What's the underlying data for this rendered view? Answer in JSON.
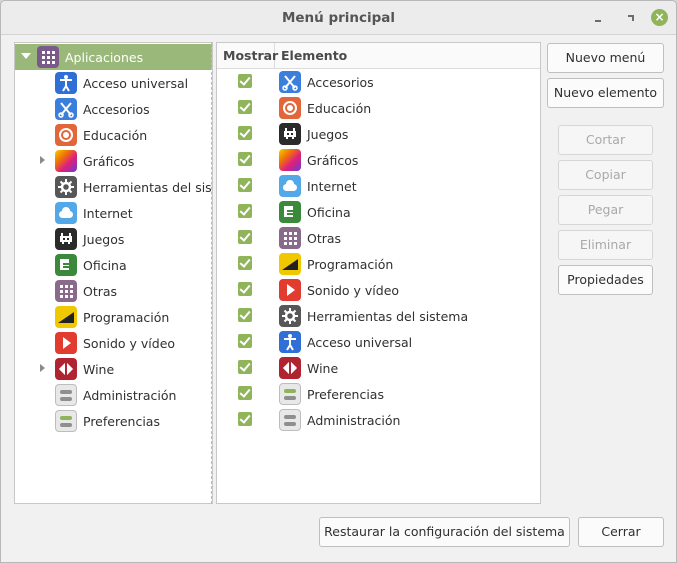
{
  "window": {
    "title": "Menú principal"
  },
  "tree": {
    "items": [
      {
        "label": "Aplicaciones",
        "icon": "applications-icon"
      },
      {
        "label": "Acceso universal",
        "icon": "accessibility-icon"
      },
      {
        "label": "Accesorios",
        "icon": "accessories-icon"
      },
      {
        "label": "Educación",
        "icon": "education-icon"
      },
      {
        "label": "Gráficos",
        "icon": "graphics-icon"
      },
      {
        "label": "Herramientas del sister",
        "icon": "system-tools-icon"
      },
      {
        "label": "Internet",
        "icon": "internet-icon"
      },
      {
        "label": "Juegos",
        "icon": "games-icon"
      },
      {
        "label": "Oficina",
        "icon": "office-icon"
      },
      {
        "label": "Otras",
        "icon": "other-icon"
      },
      {
        "label": "Programación",
        "icon": "programming-icon"
      },
      {
        "label": "Sonido y vídeo",
        "icon": "sound-video-icon"
      },
      {
        "label": "Wine",
        "icon": "wine-icon"
      },
      {
        "label": "Administración",
        "icon": "administration-icon"
      },
      {
        "label": "Preferencias",
        "icon": "preferences-icon"
      }
    ]
  },
  "list": {
    "headers": {
      "show": "Mostrar",
      "item": "Elemento"
    },
    "items": [
      {
        "label": "Accesorios",
        "icon": "accessories-icon",
        "shown": true
      },
      {
        "label": "Educación",
        "icon": "education-icon",
        "shown": true
      },
      {
        "label": "Juegos",
        "icon": "games-icon",
        "shown": true
      },
      {
        "label": "Gráficos",
        "icon": "graphics-icon",
        "shown": true
      },
      {
        "label": "Internet",
        "icon": "internet-icon",
        "shown": true
      },
      {
        "label": "Oficina",
        "icon": "office-icon",
        "shown": true
      },
      {
        "label": "Otras",
        "icon": "other-icon",
        "shown": true
      },
      {
        "label": "Programación",
        "icon": "programming-icon",
        "shown": true
      },
      {
        "label": "Sonido y vídeo",
        "icon": "sound-video-icon",
        "shown": true
      },
      {
        "label": "Herramientas del sistema",
        "icon": "system-tools-icon",
        "shown": true
      },
      {
        "label": "Acceso universal",
        "icon": "accessibility-icon",
        "shown": true
      },
      {
        "label": "Wine",
        "icon": "wine-icon",
        "shown": true
      },
      {
        "label": "Preferencias",
        "icon": "preferences-icon",
        "shown": true
      },
      {
        "label": "Administración",
        "icon": "administration-icon",
        "shown": true
      }
    ]
  },
  "buttons": {
    "new_menu": "Nuevo menú",
    "new_item": "Nuevo elemento",
    "cut": "Cortar",
    "copy": "Copiar",
    "paste": "Pegar",
    "delete": "Eliminar",
    "properties": "Propiedades",
    "restore": "Restaurar la configuración del sistema",
    "close": "Cerrar"
  },
  "colors": {
    "accent": "#8fb45a",
    "selection": "#9ab87a"
  }
}
